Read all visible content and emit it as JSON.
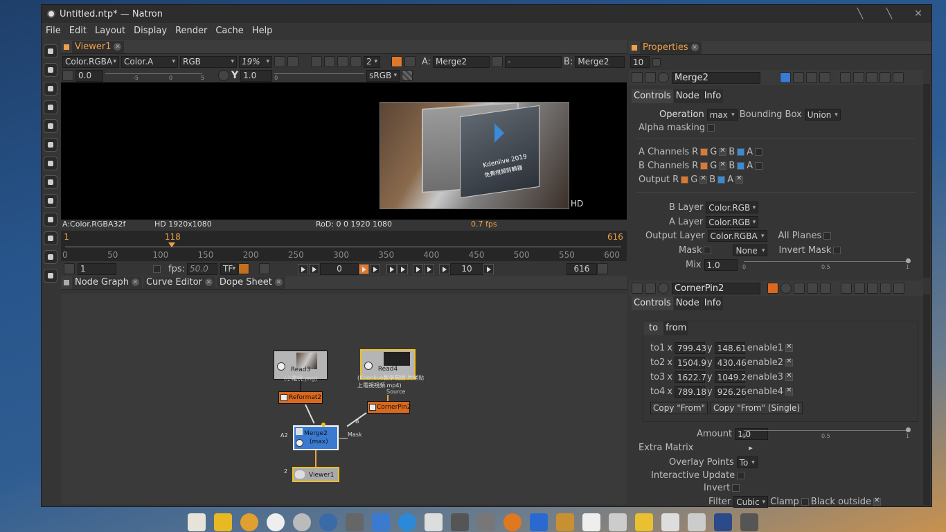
{
  "window": {
    "title": "Untitled.ntp* — Natron"
  },
  "menu": [
    "File",
    "Edit",
    "Layout",
    "Display",
    "Render",
    "Cache",
    "Help"
  ],
  "viewer": {
    "tab": "Viewer1",
    "layer": "Color.RGBA",
    "alpha": "Color.A",
    "channels": "RGB",
    "zoom": "19%",
    "input_a_label": "A:",
    "input_a": "Merge2",
    "op": "-",
    "input_b_label": "B:",
    "input_b": "Merge2",
    "gain": "0.0",
    "gain_ticks": [
      "-5",
      "0",
      "5"
    ],
    "gamma_label": "Y",
    "gamma": "1.0",
    "gamma_tick": "0",
    "colorspace": "sRGB",
    "proxy": "2",
    "format_label": "HD",
    "status_left": "A:Color.RGBA32f",
    "status_format": "HD 1920x1080",
    "status_rod": "RoD: 0 0 1920 1080",
    "status_fps": "0.7 fps",
    "image_text": "Kdenlive 2019",
    "image_text2": "免費視頻剪輯器"
  },
  "timeline": {
    "current": "118",
    "start": "1",
    "end": "616",
    "ticks": [
      "0",
      "50",
      "100",
      "150",
      "200",
      "250",
      "300",
      "350",
      "400",
      "450",
      "500",
      "550",
      "600"
    ],
    "tick_values": [
      0,
      50,
      100,
      150,
      200,
      250,
      300,
      350,
      400,
      450,
      500,
      550,
      600
    ],
    "max": 616,
    "current_value": 118,
    "start_frame": "1",
    "fps_label": "fps:",
    "fps": "50.0",
    "tf": "TF",
    "frame": "0",
    "step": "10",
    "end_frame": "616"
  },
  "graph": {
    "tabs": [
      "Node Graph",
      "Curve Editor",
      "Dope Sheet"
    ],
    "nodes": {
      "read3": {
        "name": "Read3",
        "sub": "(小電視.png)"
      },
      "read4": {
        "name": "Read4",
        "sub": "(Kdenlive教學開頭 片尾貼",
        "sub2": "上電視視頻.mp4)"
      },
      "reformat": "Reformat2",
      "cornerpin": "CornerPin2",
      "merge": "Merge2",
      "merge_sub": "(max)",
      "viewer": "Viewer1",
      "source_label": "Source",
      "a2": "A2",
      "b": "B",
      "mask": "Mask",
      "two": "2"
    }
  },
  "properties": {
    "tab": "Properties",
    "max_panels": "10",
    "merge": {
      "name": "Merge2",
      "subtabs": [
        "Controls",
        "Node",
        "Info"
      ],
      "operation_label": "Operation",
      "operation": "max",
      "bbox_label": "Bounding Box",
      "bbox": "Union",
      "alpha_masking": "Alpha masking",
      "a_channels": "A Channels",
      "b_channels": "B Channels",
      "output": "Output",
      "rgba": [
        "R",
        "G",
        "B",
        "A"
      ],
      "b_layer_label": "B Layer",
      "b_layer": "Color.RGB",
      "a_layer_label": "A Layer",
      "a_layer": "Color.RGB",
      "out_layer_label": "Output Layer",
      "out_layer": "Color.RGBA",
      "all_planes": "All Planes",
      "mask_label": "Mask",
      "mask": "None",
      "invert_mask": "Invert Mask",
      "mix_label": "Mix",
      "mix": "1.0",
      "mix_ticks": [
        "0",
        "0.5",
        "1"
      ],
      "mix_value": 1.0
    },
    "cornerpin": {
      "name": "CornerPin2",
      "subtabs": [
        "Controls",
        "Node",
        "Info"
      ],
      "inner_tabs": [
        "to",
        "from"
      ],
      "rows": [
        {
          "label": "to1",
          "x": "799.43",
          "y": "148.61",
          "en": "enable1"
        },
        {
          "label": "to2",
          "x": "1504.9",
          "y": "430.46",
          "en": "enable2"
        },
        {
          "label": "to3",
          "x": "1622.7",
          "y": "1049.2",
          "en": "enable3"
        },
        {
          "label": "to4",
          "x": "789.18",
          "y": "926.26",
          "en": "enable4"
        }
      ],
      "x_label": "x",
      "y_label": "y",
      "copy_from": "Copy \"From\"",
      "copy_from_single": "Copy \"From\" (Single)",
      "amount_label": "Amount",
      "amount": "1.0",
      "amount_ticks": [
        "0",
        "0.5",
        "1"
      ],
      "amount_value": 1.0,
      "extra_matrix": "Extra Matrix",
      "overlay_label": "Overlay Points",
      "overlay": "To",
      "interactive": "Interactive Update",
      "invert": "Invert",
      "filter_label": "Filter",
      "filter": "Cubic",
      "clamp": "Clamp",
      "black_outside": "Black outside"
    }
  },
  "colors": {
    "accent": "#f0a04a",
    "blue": "#3a8ad8",
    "bg": "#353535"
  }
}
